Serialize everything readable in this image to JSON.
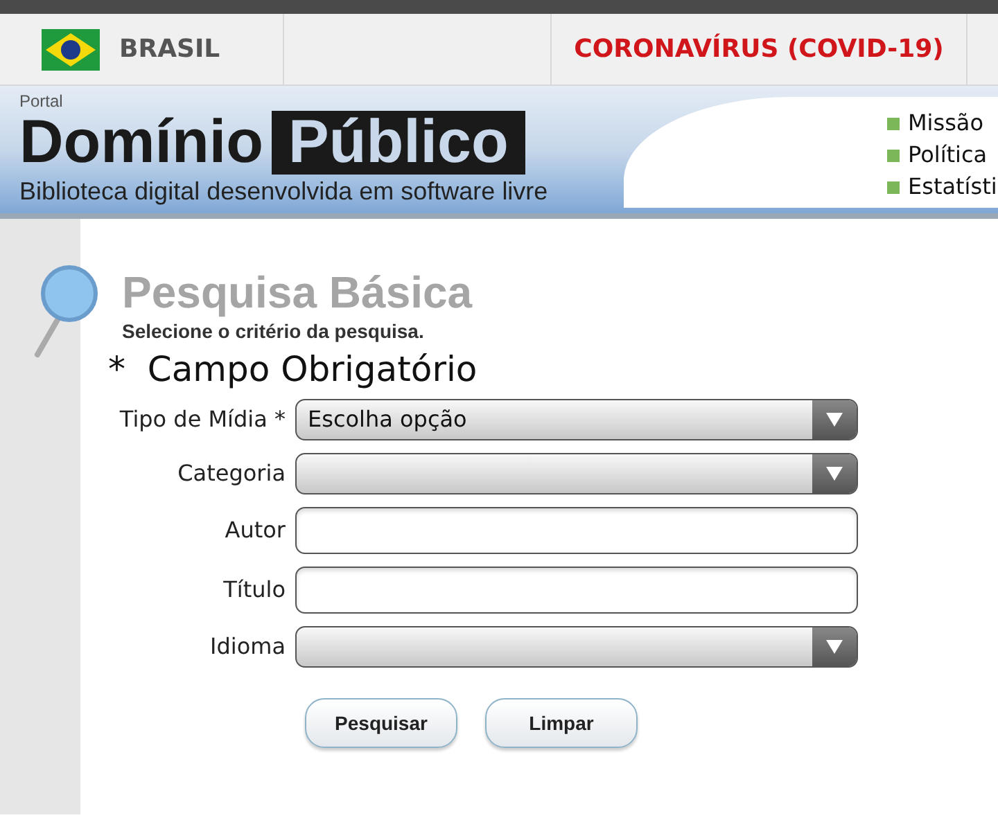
{
  "top_bar": {
    "country": "BRASIL",
    "alert": "CORONAVÍRUS (COVID-19)"
  },
  "banner": {
    "portal": "Portal",
    "title_1": "Domínio",
    "title_2": "Público",
    "subtitle": "Biblioteca digital desenvolvida em software livre",
    "links": [
      "Missão",
      "Política",
      "Estatísti"
    ]
  },
  "search": {
    "title": "Pesquisa Básica",
    "subtitle": "Selecione o critério da pesquisa.",
    "required_note": "*  Campo Obrigatório",
    "fields": [
      {
        "label": "Tipo de Mídia *",
        "kind": "select",
        "value": "Escolha opção"
      },
      {
        "label": "Categoria",
        "kind": "select"
      },
      {
        "label": "Autor",
        "kind": "text"
      },
      {
        "label": "Título",
        "kind": "text"
      },
      {
        "label": "Idioma",
        "kind": "select"
      }
    ],
    "buttons": [
      "Pesquisar",
      "Limpar"
    ]
  }
}
